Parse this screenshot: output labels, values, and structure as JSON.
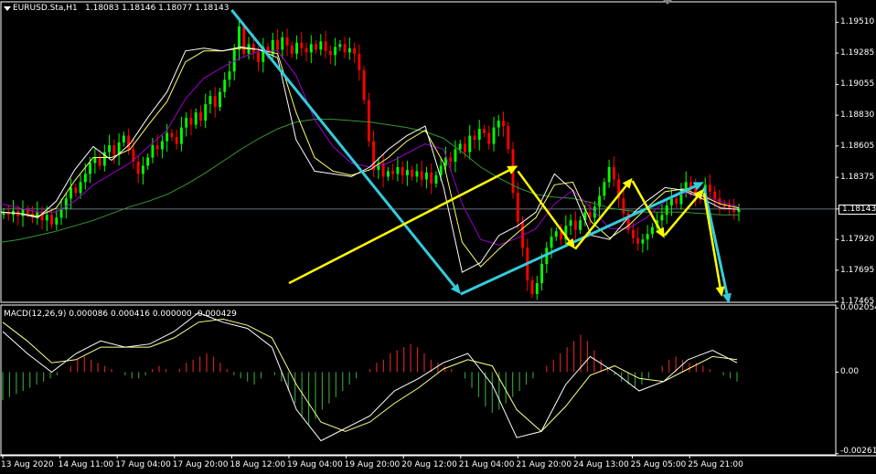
{
  "header": {
    "symbol": "EURUSD.Sta,H1",
    "ohlc": "1.18083 1.18146 1.18077 1.18143"
  },
  "indicator": {
    "label": "MACD(12,26,9) 0.000086 0.000416 0.000000 -0.000429"
  },
  "colors": {
    "background": "#000000",
    "bull_candle": "#00ff00",
    "bear_candle": "#ff0000",
    "ma_fast": "#ffffff",
    "ma_2": "#ffff66",
    "ma_3": "#9900cc",
    "ma_slow": "#339933",
    "arrow_cyan": "#33ccdd",
    "arrow_yellow": "#ffff00",
    "macd_pos": "#cc2222",
    "macd_neg": "#339933",
    "signal_line": "#ffff88"
  },
  "chart_data": [
    {
      "type": "candlestick",
      "title": "EURUSD.Sta,H1",
      "timeframe": "H1",
      "y_ticks": [
        "1.19510",
        "1.19285",
        "1.19055",
        "1.18830",
        "1.18605",
        "1.18375",
        "1.18143",
        "1.17920",
        "1.17695",
        "1.17465"
      ],
      "y_tick_values": [
        1.1951,
        1.19285,
        1.19055,
        1.1883,
        1.18605,
        1.18375,
        1.18143,
        1.1792,
        1.17695,
        1.17465
      ],
      "ylim": [
        1.1746,
        1.1966
      ],
      "current_price": 1.18143,
      "x_ticks": [
        "13 Aug 2020",
        "14 Aug 11:00",
        "17 Aug 04:00",
        "17 Aug 20:00",
        "18 Aug 12:00",
        "19 Aug 04:00",
        "19 Aug 20:00",
        "20 Aug 12:00",
        "21 Aug 04:00",
        "21 Aug 20:00",
        "24 Aug 13:00",
        "25 Aug 05:00",
        "25 Aug 21:00"
      ],
      "close_series": [
        1.1812,
        1.181,
        1.1813,
        1.1809,
        1.1814,
        1.1811,
        1.1808,
        1.1812,
        1.1806,
        1.181,
        1.1803,
        1.1808,
        1.1814,
        1.1822,
        1.183,
        1.1826,
        1.1834,
        1.184,
        1.1848,
        1.1852,
        1.1846,
        1.1856,
        1.1861,
        1.1854,
        1.1863,
        1.1868,
        1.1858,
        1.1849,
        1.184,
        1.1846,
        1.1852,
        1.1861,
        1.1858,
        1.1864,
        1.187,
        1.1867,
        1.1862,
        1.1874,
        1.1881,
        1.1876,
        1.1885,
        1.1879,
        1.1891,
        1.1897,
        1.1889,
        1.19,
        1.1909,
        1.1915,
        1.1931,
        1.1948,
        1.1928,
        1.1935,
        1.1929,
        1.1922,
        1.1933,
        1.1927,
        1.1938,
        1.1931,
        1.194,
        1.1934,
        1.1928,
        1.1936,
        1.1932,
        1.1929,
        1.1935,
        1.1931,
        1.1937,
        1.193,
        1.1927,
        1.1933,
        1.1935,
        1.1929,
        1.1932,
        1.1928,
        1.1916,
        1.1894,
        1.1864,
        1.1843,
        1.1848,
        1.1838,
        1.1842,
        1.184,
        1.1845,
        1.1839,
        1.1843,
        1.1838,
        1.1842,
        1.1836,
        1.1841,
        1.1833,
        1.1839,
        1.1846,
        1.1852,
        1.1849,
        1.1858,
        1.1862,
        1.1856,
        1.1868,
        1.1865,
        1.1873,
        1.187,
        1.1862,
        1.1874,
        1.1879,
        1.1875,
        1.1858,
        1.1826,
        1.1805,
        1.1786,
        1.1762,
        1.1752,
        1.176,
        1.1774,
        1.1786,
        1.1794,
        1.1798,
        1.1792,
        1.1802,
        1.1806,
        1.1799,
        1.1806,
        1.1812,
        1.1808,
        1.1816,
        1.1824,
        1.1834,
        1.1845,
        1.1836,
        1.1822,
        1.1811,
        1.1799,
        1.1793,
        1.1789,
        1.1792,
        1.1796,
        1.1801,
        1.1806,
        1.181,
        1.1817,
        1.1822,
        1.1818,
        1.1828,
        1.1834,
        1.183,
        1.1824,
        1.1821,
        1.1832,
        1.1827,
        1.1822,
        1.1818,
        1.1816,
        1.1814,
        1.1812,
        1.1814
      ],
      "ma_fast": [
        1.1812,
        1.1811,
        1.1808,
        1.182,
        1.1843,
        1.186,
        1.185,
        1.1862,
        1.1882,
        1.19,
        1.193,
        1.1932,
        1.193,
        1.1933,
        1.1931,
        1.1925,
        1.1865,
        1.1842,
        1.184,
        1.1838,
        1.1845,
        1.1858,
        1.1868,
        1.1875,
        1.183,
        1.1768,
        1.1775,
        1.1795,
        1.1802,
        1.1812,
        1.184,
        1.1828,
        1.1795,
        1.1792,
        1.1808,
        1.182,
        1.183,
        1.1828,
        1.1822,
        1.1815,
        1.1814
      ],
      "ma_2": [
        1.1812,
        1.1811,
        1.1809,
        1.1815,
        1.1835,
        1.1852,
        1.1852,
        1.1858,
        1.1876,
        1.1893,
        1.1922,
        1.193,
        1.193,
        1.1932,
        1.1931,
        1.1928,
        1.1885,
        1.1852,
        1.1842,
        1.1839,
        1.1843,
        1.1852,
        1.1864,
        1.1872,
        1.1848,
        1.179,
        1.1772,
        1.1785,
        1.1797,
        1.1808,
        1.1832,
        1.1834,
        1.1805,
        1.1793,
        1.1802,
        1.1815,
        1.1827,
        1.1829,
        1.1824,
        1.1818,
        1.1815
      ],
      "ma_3": [
        1.1818,
        1.1815,
        1.1812,
        1.1812,
        1.182,
        1.1832,
        1.184,
        1.1848,
        1.186,
        1.1872,
        1.1895,
        1.191,
        1.1918,
        1.1925,
        1.193,
        1.193,
        1.1912,
        1.188,
        1.186,
        1.1848,
        1.1845,
        1.1848,
        1.1855,
        1.1862,
        1.1858,
        1.1818,
        1.1792,
        1.1788,
        1.1793,
        1.18,
        1.1818,
        1.1828,
        1.1815,
        1.18,
        1.18,
        1.1808,
        1.182,
        1.1826,
        1.1824,
        1.182,
        1.1816
      ],
      "ma_slow": [
        1.179,
        1.1792,
        1.1795,
        1.1798,
        1.1802,
        1.1806,
        1.1811,
        1.1816,
        1.182,
        1.1825,
        1.1832,
        1.184,
        1.1849,
        1.1858,
        1.1866,
        1.1873,
        1.1878,
        1.188,
        1.188,
        1.1879,
        1.1878,
        1.1876,
        1.1874,
        1.1871,
        1.1866,
        1.1856,
        1.1845,
        1.1837,
        1.183,
        1.1825,
        1.1823,
        1.1822,
        1.1819,
        1.1815,
        1.1813,
        1.1812,
        1.1812,
        1.1812,
        1.1811,
        1.181,
        1.181
      ]
    },
    {
      "type": "bar",
      "title": "MACD(12,26,9) 0.000086 0.000416 0.000000 -0.000429",
      "y_ticks": [
        "0.002054",
        "0.00",
        "-0.002611"
      ],
      "y_tick_values": [
        0.002054,
        0.0,
        -0.002611
      ],
      "ylim": [
        -0.00265,
        0.00215
      ],
      "histogram": [
        -0.0009,
        -0.0008,
        -0.0007,
        -0.0006,
        -0.0005,
        -0.0004,
        -0.0003,
        -0.0002,
        -0.0001,
        0.0,
        0.0002,
        0.0004,
        0.0005,
        0.0004,
        0.0003,
        0.0002,
        0.0001,
        0.0,
        -0.0001,
        -0.0002,
        -0.0002,
        -0.0001,
        0.0001,
        0.0002,
        0.0001,
        0.0,
        0.0001,
        0.0003,
        0.0004,
        0.0005,
        0.0006,
        0.0005,
        0.0003,
        0.0001,
        -0.0001,
        -0.0002,
        -0.0003,
        -0.0004,
        -0.0002,
        0.0,
        -0.0001,
        -0.0003,
        -0.0006,
        -0.001,
        -0.0014,
        -0.0017,
        -0.0015,
        -0.0012,
        -0.001,
        -0.0008,
        -0.0006,
        -0.0004,
        -0.0002,
        0.0,
        0.0001,
        0.0003,
        0.0004,
        0.0006,
        0.0007,
        0.0008,
        0.0009,
        0.0008,
        0.0006,
        0.0004,
        0.0003,
        0.0002,
        0.0001,
        0.0,
        -0.0002,
        -0.0005,
        -0.0008,
        -0.0011,
        -0.0013,
        -0.0012,
        -0.001,
        -0.0008,
        -0.0006,
        -0.0004,
        -0.0002,
        0.0,
        0.0002,
        0.0004,
        0.0006,
        0.0008,
        0.001,
        0.0012,
        0.001,
        0.0007,
        0.0004,
        0.0001,
        -0.0001,
        -0.0003,
        -0.0004,
        -0.0005,
        -0.0004,
        -0.0002,
        0.0,
        0.0002,
        0.0004,
        0.0005,
        0.0004,
        0.0003,
        0.0003,
        0.0002,
        0.0001,
        0.0,
        -0.0001,
        -0.0002,
        -0.0003
      ],
      "macd_line": [
        0.0013,
        0.0006,
        0.0,
        0.0006,
        0.001,
        0.0008,
        0.0009,
        0.0013,
        0.0019,
        0.0016,
        0.0014,
        0.0008,
        -0.0012,
        -0.0022,
        -0.0018,
        -0.0014,
        -0.0006,
        -0.0002,
        0.0003,
        0.0006,
        -0.0004,
        -0.0021,
        -0.0019,
        -0.0004,
        0.0005,
        0.0,
        -0.0006,
        -0.0003,
        0.0004,
        0.0007,
        0.0003
      ],
      "signal_line": [
        0.0016,
        0.001,
        0.0003,
        0.0004,
        0.0008,
        0.0008,
        0.0008,
        0.0011,
        0.0016,
        0.0017,
        0.0015,
        0.0011,
        -0.0004,
        -0.0016,
        -0.0019,
        -0.0016,
        -0.001,
        -0.0005,
        0.0001,
        0.0004,
        0.0002,
        -0.0012,
        -0.0019,
        -0.0011,
        -0.0001,
        0.0002,
        -0.0002,
        -0.0003,
        0.0001,
        0.0005,
        0.0004
      ]
    }
  ],
  "annotations": {
    "cyan_arrows": [
      {
        "from": [
          "18 Aug 12:00",
          1.196
        ],
        "to": [
          "21 Aug 04:00",
          1.1752
        ]
      },
      {
        "from": [
          "21 Aug 04:00",
          1.1752
        ],
        "to": [
          "26 Aug 01:00",
          1.1834
        ]
      },
      {
        "from": [
          "26 Aug 01:00",
          1.183
        ],
        "to": [
          "26 Aug 08:00",
          1.1745
        ]
      }
    ],
    "yellow_arrows": [
      {
        "from": [
          "21 Aug 05:00",
          1.176
        ],
        "to": [
          "21 Aug 20:00",
          1.1846
        ]
      },
      {
        "from": [
          "21 Aug 20:00",
          1.1842
        ],
        "to": [
          "24 Aug 13:00",
          1.1785
        ]
      },
      {
        "from": [
          "24 Aug 13:00",
          1.1785
        ],
        "to": [
          "25 Aug 05:00",
          1.1837
        ]
      },
      {
        "from": [
          "25 Aug 05:00",
          1.1835
        ],
        "to": [
          "25 Aug 14:00",
          1.1793
        ]
      },
      {
        "from": [
          "25 Aug 14:00",
          1.1795
        ],
        "to": [
          "26 Aug 01:00",
          1.1829
        ]
      },
      {
        "from": [
          "26 Aug 01:00",
          1.1826
        ],
        "to": [
          "26 Aug 06:00",
          1.175
        ]
      }
    ]
  }
}
